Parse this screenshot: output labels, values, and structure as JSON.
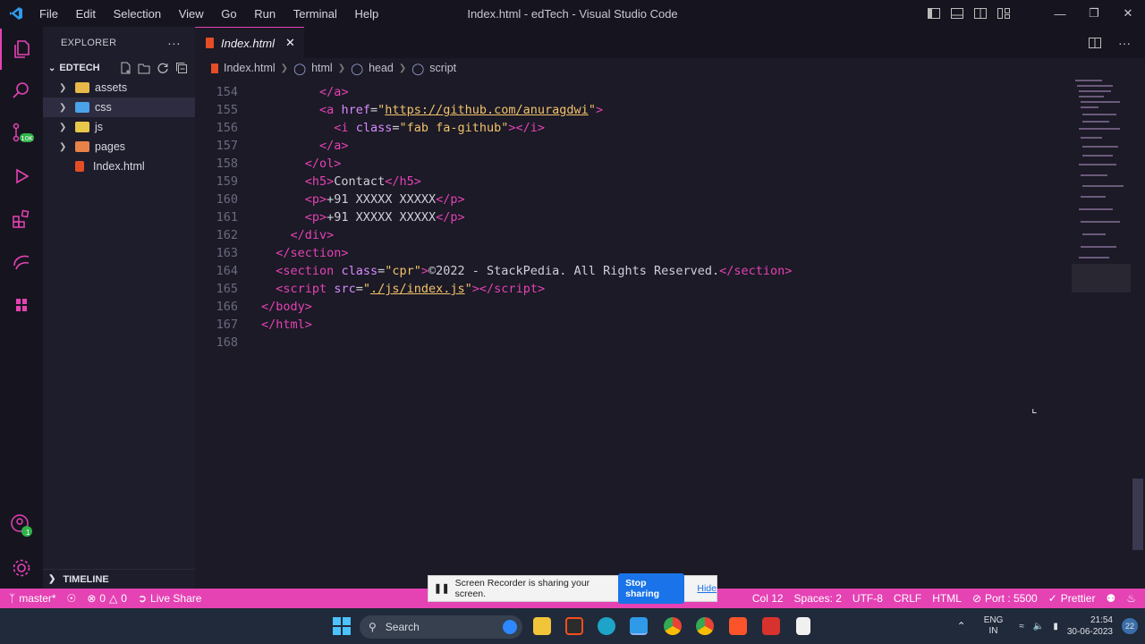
{
  "window": {
    "title": "Index.html - edTech - Visual Studio Code",
    "menu": [
      "File",
      "Edit",
      "Selection",
      "View",
      "Go",
      "Run",
      "Terminal",
      "Help"
    ]
  },
  "sidebar": {
    "header": "EXPLORER",
    "root": "EDTECH",
    "items": [
      {
        "label": "assets",
        "kind": "folder",
        "color": "#e8b94a"
      },
      {
        "label": "css",
        "kind": "folder",
        "color": "#4aa3e8"
      },
      {
        "label": "js",
        "kind": "folder",
        "color": "#e8c84a"
      },
      {
        "label": "pages",
        "kind": "folder",
        "color": "#e8824a"
      },
      {
        "label": "Index.html",
        "kind": "file",
        "color": "#e44d26"
      }
    ],
    "timeline": "TIMELINE"
  },
  "editor": {
    "tab": "Index.html",
    "breadcrumb": [
      "Index.html",
      "html",
      "head",
      "script"
    ],
    "lines": [
      {
        "n": "154",
        "html": "        <span class='tg'>&lt;/</span><span class='tg'>a</span><span class='tg'>&gt;</span>"
      },
      {
        "n": "155",
        "html": "        <span class='tg'>&lt;a</span> <span class='at'>href</span>=<span class='st'>\"</span><span class='url'>https://github.com/anuragdwi</span><span class='st'>\"</span><span class='tg'>&gt;</span>"
      },
      {
        "n": "156",
        "html": "          <span class='tg'>&lt;i</span> <span class='at'>class</span>=<span class='st'>\"fab fa-github\"</span><span class='tg'>&gt;&lt;/i&gt;</span>"
      },
      {
        "n": "157",
        "html": "        <span class='tg'>&lt;/a&gt;</span>"
      },
      {
        "n": "158",
        "html": "      <span class='tg'>&lt;/ol&gt;</span>"
      },
      {
        "n": "159",
        "html": "      <span class='tg'>&lt;h5&gt;</span><span class='pl'>Contact</span><span class='tg'>&lt;/h5&gt;</span>"
      },
      {
        "n": "160",
        "html": "      <span class='tg'>&lt;p&gt;</span><span class='pl'>+91 XXXXX XXXXX</span><span class='tg'>&lt;/p&gt;</span>"
      },
      {
        "n": "161",
        "html": "      <span class='tg'>&lt;p&gt;</span><span class='pl'>+91 XXXXX XXXXX</span><span class='tg'>&lt;/p&gt;</span>"
      },
      {
        "n": "162",
        "html": "    <span class='tg'>&lt;/div&gt;</span>"
      },
      {
        "n": "163",
        "html": "  <span class='tg'>&lt;/section&gt;</span>"
      },
      {
        "n": "164",
        "html": "  <span class='tg'>&lt;section</span> <span class='at'>class</span>=<span class='st'>\"cpr\"</span><span class='tg'>&gt;</span><span class='pl'>©2022 - StackPedia. All Rights Reserved.</span><span class='tg'>&lt;/section&gt;</span>"
      },
      {
        "n": "165",
        "html": "  <span class='tg'>&lt;script</span> <span class='at'>src</span>=<span class='st'>\"</span><span class='url'>./js/index.js</span><span class='st'>\"</span><span class='tg'>&gt;&lt;/script&gt;</span>"
      },
      {
        "n": "166",
        "html": "<span class='tg'>&lt;/body&gt;</span>"
      },
      {
        "n": "167",
        "html": "<span class='tg'>&lt;/html&gt;</span>"
      },
      {
        "n": "168",
        "html": ""
      }
    ]
  },
  "status": {
    "branch": "master*",
    "errors": "0",
    "warnings": "0",
    "liveshare": "Live Share",
    "col": "Col 12",
    "spaces": "Spaces: 2",
    "encoding": "UTF-8",
    "eol": "CRLF",
    "language": "HTML",
    "port": "Port : 5500",
    "prettier": "Prettier"
  },
  "notification": {
    "text": "Screen Recorder is sharing your screen.",
    "stop": "Stop sharing",
    "hide": "Hide"
  },
  "taskbar": {
    "search": "Search",
    "lang1": "ENG",
    "lang2": "IN",
    "time": "21:54",
    "date": "30-06-2023",
    "badge": "22"
  },
  "accounts_badge": "1",
  "colors": {
    "accent": "#e542b4",
    "bg": "#1b1a26"
  }
}
